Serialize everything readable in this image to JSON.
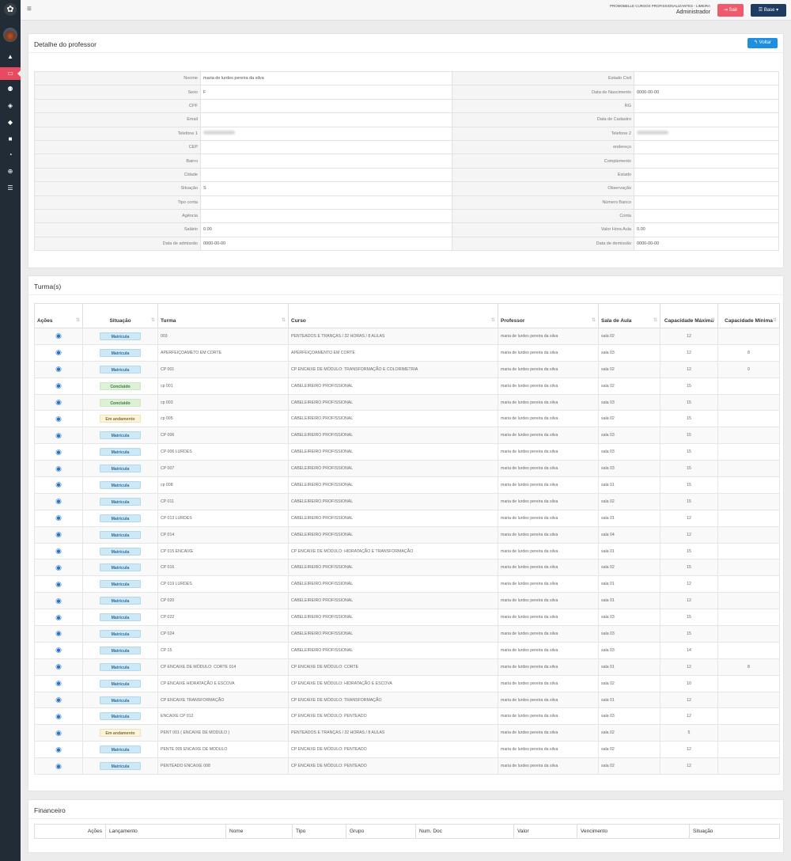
{
  "sidebar": {
    "nav_items": [
      {
        "name": "dashboard-icon",
        "glyph": "▲"
      },
      {
        "name": "laptop-icon",
        "glyph": "▭"
      },
      {
        "name": "users-icon",
        "glyph": "⚉"
      },
      {
        "name": "box-icon",
        "glyph": "◈"
      },
      {
        "name": "graduation-icon",
        "glyph": "◆"
      },
      {
        "name": "book-icon",
        "glyph": "■"
      },
      {
        "name": "pie-icon",
        "glyph": "◔"
      },
      {
        "name": "plus-circle-icon",
        "glyph": "⊕"
      },
      {
        "name": "list-icon",
        "glyph": "☰"
      }
    ],
    "active_index": 1
  },
  "header": {
    "company": "PROMOBELLE CURSOS PROFISSIONALIZANTES - LIMEIRA",
    "role": "Administrador",
    "logout_label": "Sair",
    "base_label": "Base"
  },
  "professor": {
    "title": "Detalhe do professor",
    "back_label": "Voltar",
    "rows": [
      {
        "l1": "Noome",
        "v1": "maria de lurdes pereira da silva",
        "l2": "Estado Civil",
        "v2": ""
      },
      {
        "l1": "Sexo",
        "v1": "F",
        "l2": "Data de Nascimento",
        "v2": "0000-00-00"
      },
      {
        "l1": "CPF",
        "v1": "",
        "l2": "RG",
        "v2": ""
      },
      {
        "l1": "Email",
        "v1": "",
        "l2": "Data de Cadastro",
        "v2": ""
      },
      {
        "l1": "Telefone 1",
        "v1": "",
        "l2": "Telefone 2",
        "v2": "",
        "blur": true
      },
      {
        "l1": "CEP",
        "v1": "",
        "l2": "endereço",
        "v2": ""
      },
      {
        "l1": "Bairro",
        "v1": "",
        "l2": "Complemento",
        "v2": ""
      },
      {
        "l1": "Cidade",
        "v1": "",
        "l2": "Estado",
        "v2": ""
      },
      {
        "l1": "Situação",
        "v1": "S",
        "l2": "Observação",
        "v2": ""
      },
      {
        "l1": "Tipo conta",
        "v1": "",
        "l2": "Número Banco",
        "v2": ""
      },
      {
        "l1": "Agência",
        "v1": "",
        "l2": "Conta",
        "v2": ""
      },
      {
        "l1": "Salário",
        "v1": "0.00",
        "l2": "Valor Hora Aula",
        "v2": "0.00"
      },
      {
        "l1": "Data de admissão",
        "v1": "0000-00-00",
        "l2": "Data de demissão",
        "v2": "0000-00-00"
      }
    ]
  },
  "turmas": {
    "title": "Turma(s)",
    "headers": [
      "Ações",
      "Situação",
      "Turma",
      "Curso",
      "Professor",
      "Sala de Aula",
      "Capacidade Máxima",
      "Capacidade Mínima"
    ],
    "rows": [
      {
        "s": "Matricula",
        "t": "003",
        "c": "PENTEADOS E TRANÇAS / 32 HORAS / 8 AULAS",
        "p": "maria de lurdes pereira da silva",
        "sala": "sala 02",
        "max": "12",
        "min": ""
      },
      {
        "s": "Matricula",
        "t": "APERFEIÇOAMETO EM CORTE",
        "c": "APERFEIÇOAMENTO EM CORTE",
        "p": "maria de lurdes pereira da silva",
        "sala": "sala 03",
        "max": "12",
        "min": "8"
      },
      {
        "s": "Matricula",
        "t": "CP 001",
        "c": "CP ENCAIXE DE MÓDULO: TRANSFORMAÇÃO E COLORIMETRIA",
        "p": "maria de lurdes pereira da silva",
        "sala": "sala 02",
        "max": "12",
        "min": "0"
      },
      {
        "s": "Concluido",
        "t": "cp 001",
        "c": "CABELEIREIRO PROFISSIONAL",
        "p": "maria de lurdes pereira da silva",
        "sala": "sala 02",
        "max": "15",
        "min": ""
      },
      {
        "s": "Concluido",
        "t": "cp 003",
        "c": "CABELEIREIRO PROFISSIONAL",
        "p": "maria de lurdes pereira da silva",
        "sala": "sala 03",
        "max": "15",
        "min": ""
      },
      {
        "s": "Em andamento",
        "t": "cp 005",
        "c": "CABELEIREIRO PROFISSIONAL",
        "p": "maria de lurdes pereira da silva",
        "sala": "sala 02",
        "max": "15",
        "min": ""
      },
      {
        "s": "Matricula",
        "t": "CP 006",
        "c": "CABELEIREIRO PROFISSIONAL",
        "p": "maria de lurdes pereira da silva",
        "sala": "sala 03",
        "max": "15",
        "min": ""
      },
      {
        "s": "Matricula",
        "t": "CP 006 LURDES",
        "c": "CABELEIREIRO PROFISSIONAL",
        "p": "maria de lurdes pereira da silva",
        "sala": "sala 03",
        "max": "15",
        "min": ""
      },
      {
        "s": "Matricula",
        "t": "CP 007",
        "c": "CABELEIREIRO PROFISSIONAL",
        "p": "maria de lurdes pereira da silva",
        "sala": "sala 03",
        "max": "15",
        "min": ""
      },
      {
        "s": "Matricula",
        "t": "cp 008",
        "c": "CABELEIREIRO PROFISSIONAL",
        "p": "maria de lurdes pereira da silva",
        "sala": "sala 01",
        "max": "15",
        "min": ""
      },
      {
        "s": "Matricula",
        "t": "CP 011",
        "c": "CABELEIREIRO PROFISSIONAL",
        "p": "maria de lurdes pereira da silva",
        "sala": "sala 02",
        "max": "15",
        "min": ""
      },
      {
        "s": "Matricula",
        "t": "CP 013 LURDES",
        "c": "CABELEIREIRO PROFISSIONAL",
        "p": "maria de lurdes pereira da silva",
        "sala": "sala 01",
        "max": "12",
        "min": ""
      },
      {
        "s": "Matricula",
        "t": "CP 014",
        "c": "CABELEIREIRO PROFISSIONAL",
        "p": "maria de lurdes pereira da silva",
        "sala": "sala 04",
        "max": "12",
        "min": ""
      },
      {
        "s": "Matricula",
        "t": "CP 015 ENCAIXE",
        "c": "CP ENCAIXE DE MÓDULO: HIDRATAÇÃO E TRANSFORMAÇÃO",
        "p": "maria de lurdes pereira da silva",
        "sala": "sala 01",
        "max": "15",
        "min": ""
      },
      {
        "s": "Matricula",
        "t": "CP 016",
        "c": "CABELEIREIRO PROFISSIONAL",
        "p": "maria de lurdes pereira da silva",
        "sala": "sala 02",
        "max": "15",
        "min": ""
      },
      {
        "s": "Matricula",
        "t": "CP 019 LURDES",
        "c": "CABELEIREIRO PROFISSIONAL",
        "p": "maria de lurdes pereira da silva",
        "sala": "sala 01",
        "max": "12",
        "min": ""
      },
      {
        "s": "Matricula",
        "t": "CP 020",
        "c": "CABELEIREIRO PROFISSIONAL",
        "p": "maria de lurdes pereira da silva",
        "sala": "sala 01",
        "max": "12",
        "min": ""
      },
      {
        "s": "Matricula",
        "t": "CP 022",
        "c": "CABELEIREIRO PROFISSIONAL",
        "p": "maria de lurdes pereira da silva",
        "sala": "sala 03",
        "max": "15",
        "min": ""
      },
      {
        "s": "Matricula",
        "t": "CP 024",
        "c": "CABELEIREIRO PROFISSIONAL",
        "p": "maria de lurdes pereira da silva",
        "sala": "sala 03",
        "max": "15",
        "min": ""
      },
      {
        "s": "Matricula",
        "t": "CP 15",
        "c": "CABELEIREIRO PROFISSIONAL",
        "p": "maria de lurdes pereira da silva",
        "sala": "sala 03",
        "max": "14",
        "min": ""
      },
      {
        "s": "Matricula",
        "t": "CP ENCAIXE DE MÓDULO: CORTE 014",
        "c": "CP ENCAIXE DE MÓDULO: CORTE",
        "p": "maria de lurdes pereira da silva",
        "sala": "sala 01",
        "max": "12",
        "min": "8"
      },
      {
        "s": "Matricula",
        "t": "CP ENCAIXE HIDRATAÇÃO E ESCOVA",
        "c": "CP ENCAIXE DE MÓDULO: HIDRATAÇÃO E ESCOVA",
        "p": "maria de lurdes pereira da silva",
        "sala": "sala 02",
        "max": "10",
        "min": ""
      },
      {
        "s": "Matricula",
        "t": "CP ENCAIXE TRANSFORMAÇÃO",
        "c": "CP ENCAIXE DE MÓDULO: TRANSFORMAÇÃO",
        "p": "maria de lurdes pereira da silva",
        "sala": "sala 01",
        "max": "12",
        "min": ""
      },
      {
        "s": "Matricula",
        "t": "ENCAIXE CP 012",
        "c": "CP ENCAIXE DE MÓDULO: PENTEADO",
        "p": "maria de lurdes pereira da silva",
        "sala": "sala 03",
        "max": "12",
        "min": ""
      },
      {
        "s": "Em andamento",
        "t": "PENT 001 ( ENCAIXE DE MODULO )",
        "c": "PENTEADOS E TRANÇAS / 32 HORAS / 8 AULAS",
        "p": "maria de lurdes pereira da silva",
        "sala": "sala 02",
        "max": "5",
        "min": ""
      },
      {
        "s": "Matricula",
        "t": "PENTE 005 ENCAIXE DE MODULO",
        "c": "CP ENCAIXE DE MÓDULO: PENTEADO",
        "p": "maria de lurdes pereira da silva",
        "sala": "sala 02",
        "max": "12",
        "min": ""
      },
      {
        "s": "Matricula",
        "t": "PENTEADO ENCAIXE 008",
        "c": "CP ENCAIXE DE MÓDULO: PENTEADO",
        "p": "maria de lurdes pereira da silva",
        "sala": "sala 02",
        "max": "12",
        "min": ""
      }
    ]
  },
  "financeiro": {
    "title": "Financeiro",
    "headers": [
      "Ações",
      "Lançamento",
      "Nome",
      "Tipo",
      "Grupo",
      "Num. Doc",
      "Valor",
      "Vencimento",
      "Situação"
    ]
  },
  "colors": {
    "sidebar": "#222c36",
    "active": "#e84a5f",
    "primary": "#1e8ee0",
    "base": "#1f3b63",
    "danger": "#ef5b6d"
  }
}
